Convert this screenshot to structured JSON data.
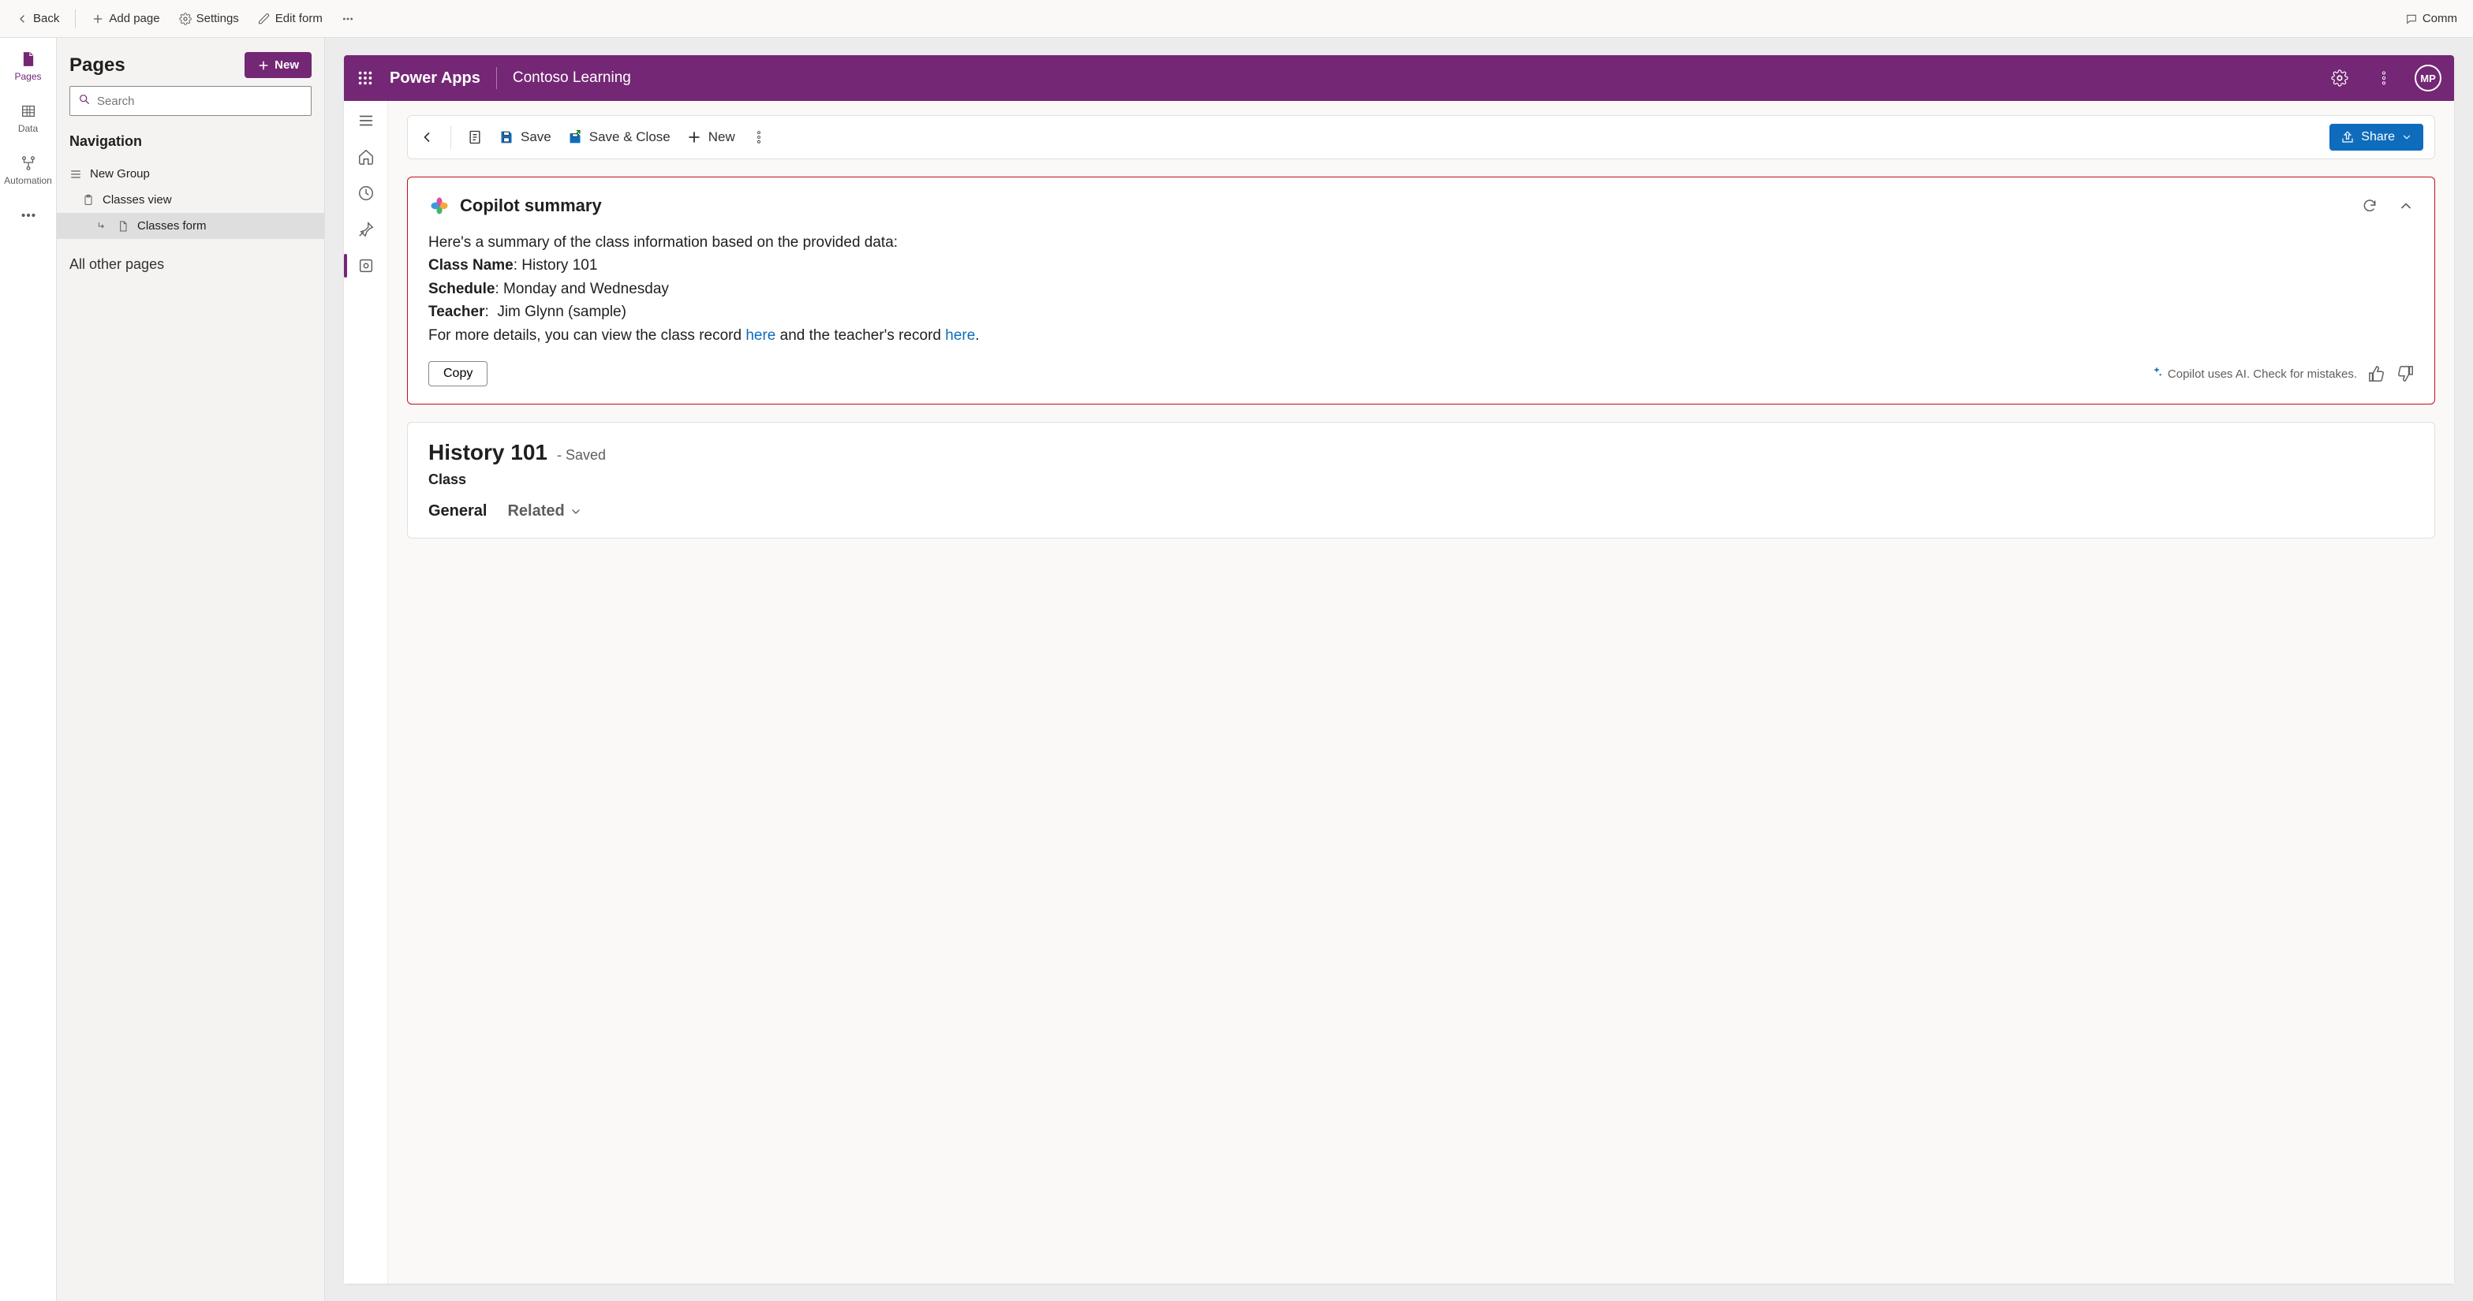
{
  "topbar": {
    "back": "Back",
    "add_page": "Add page",
    "settings": "Settings",
    "edit_form": "Edit form",
    "comments": "Comm"
  },
  "toolrail": {
    "pages": "Pages",
    "data": "Data",
    "automation": "Automation"
  },
  "sidebar": {
    "title": "Pages",
    "new_btn": "New",
    "search_placeholder": "Search",
    "nav_heading": "Navigation",
    "group": "New Group",
    "items": [
      {
        "label": "Classes view"
      },
      {
        "label": "Classes form"
      }
    ],
    "other": "All other pages"
  },
  "app_header": {
    "app_name": "Power Apps",
    "env": "Contoso Learning",
    "initials": "MP"
  },
  "form_toolbar": {
    "save": "Save",
    "save_close": "Save & Close",
    "new": "New",
    "share": "Share"
  },
  "copilot": {
    "title": "Copilot summary",
    "intro": "Here's a summary of the class information based on the provided data:",
    "class_name_label": "Class Name",
    "class_name_value": "History 101",
    "schedule_label": "Schedule",
    "schedule_value": "Monday and Wednesday",
    "teacher_label": "Teacher",
    "teacher_value": "Jim Glynn (sample)",
    "details_pre": "For more details, you can view the class record ",
    "link1": "here",
    "details_mid": " and the teacher's record ",
    "link2": "here",
    "details_post": ".",
    "copy": "Copy",
    "ai_note": "Copilot uses AI. Check for mistakes."
  },
  "record": {
    "title": "History 101",
    "saved": "- Saved",
    "subtype": "Class",
    "tab_general": "General",
    "tab_related": "Related"
  }
}
